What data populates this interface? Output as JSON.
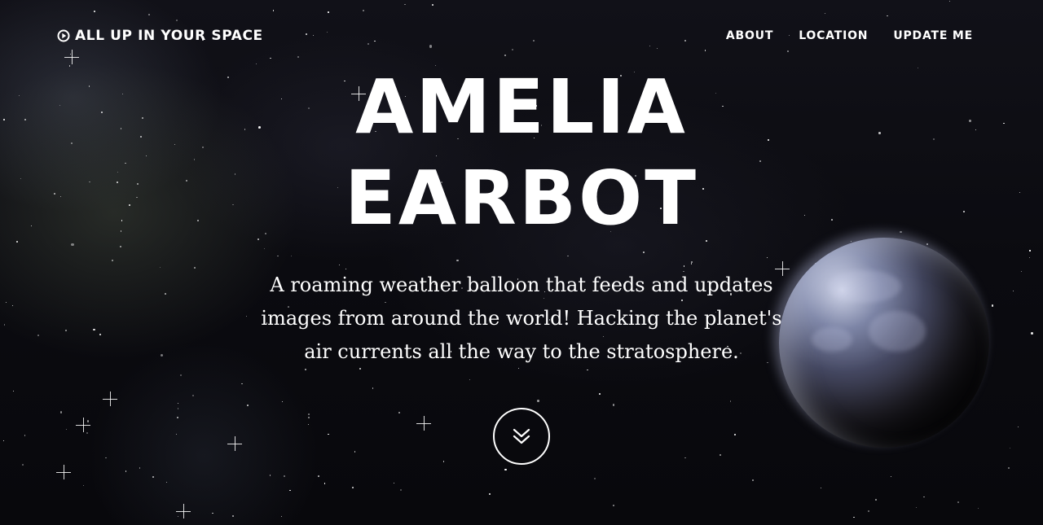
{
  "nav": {
    "brand": {
      "label": "ALL UP IN YOUR SPACE",
      "icon": "play-circle-icon"
    },
    "links": [
      "ABOUT",
      "LOCATION",
      "UPDATE ME"
    ]
  },
  "hero": {
    "title_line1": "AMELIA",
    "title_line2": "EARBOT",
    "subtitle": "A roaming weather balloon that feeds and updates images from around the world! Hacking the planet's air currents all the way to the stratosphere.",
    "scroll_icon": "double-chevron-down-icon"
  },
  "colors": {
    "text": "#ffffff",
    "background": "#0b0b10"
  }
}
